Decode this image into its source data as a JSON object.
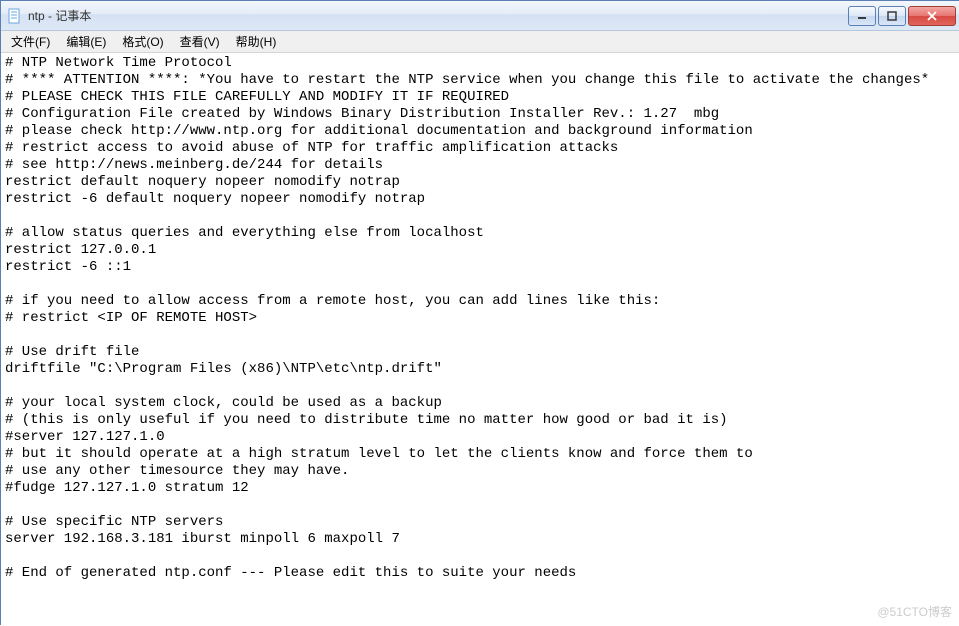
{
  "window": {
    "title": "ntp - 记事本"
  },
  "menu": {
    "file": "文件(F)",
    "edit": "编辑(E)",
    "format": "格式(O)",
    "view": "查看(V)",
    "help": "帮助(H)"
  },
  "editor": {
    "content": "# NTP Network Time Protocol\n# **** ATTENTION ****: *You have to restart the NTP service when you change this file to activate the changes*\n# PLEASE CHECK THIS FILE CAREFULLY AND MODIFY IT IF REQUIRED\n# Configuration File created by Windows Binary Distribution Installer Rev.: 1.27  mbg\n# please check http://www.ntp.org for additional documentation and background information\n# restrict access to avoid abuse of NTP for traffic amplification attacks\n# see http://news.meinberg.de/244 for details\nrestrict default noquery nopeer nomodify notrap\nrestrict -6 default noquery nopeer nomodify notrap\n\n# allow status queries and everything else from localhost\nrestrict 127.0.0.1\nrestrict -6 ::1\n\n# if you need to allow access from a remote host, you can add lines like this:\n# restrict <IP OF REMOTE HOST>\n\n# Use drift file\ndriftfile \"C:\\Program Files (x86)\\NTP\\etc\\ntp.drift\"\n\n# your local system clock, could be used as a backup\n# (this is only useful if you need to distribute time no matter how good or bad it is)\n#server 127.127.1.0\n# but it should operate at a high stratum level to let the clients know and force them to\n# use any other timesource they may have.\n#fudge 127.127.1.0 stratum 12\n\n# Use specific NTP servers\nserver 192.168.3.181 iburst minpoll 6 maxpoll 7\n\n# End of generated ntp.conf --- Please edit this to suite your needs\n"
  },
  "watermark": "@51CTO博客"
}
